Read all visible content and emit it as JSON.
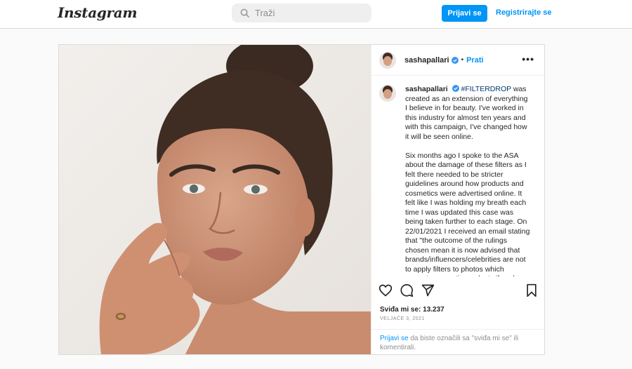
{
  "header": {
    "logo": "Instagram",
    "search_placeholder": "Traži",
    "login_label": "Prijavi se",
    "signup_label": "Registrirajte se"
  },
  "post": {
    "username": "sashapallari",
    "follow_label": "Prati",
    "more_label": "•••",
    "caption": {
      "hashtag": "#FILTERDROP",
      "text": " was created as an extension of everything I believe in for beauty. I've worked in this industry for almost ten years and with this campaign, I've changed how it will be seen online.\n\nSix months ago I spoke to the ASA about the damage of these filters as I felt there needed to be stricter guidelines around how products and cosmetics were advertised online. It felt like I was holding my breath each time I was updated this case was being taken further to each stage. On 22/01/2021 I received an email stating that \"the outcome of the rulings chosen mean it is now advised that brands/influencers/celebrities are not to apply filters to photos which promote cosmetic products if such"
    },
    "likes_text": "Sviđa mi se: 13.237",
    "date": "VELJAČE 3, 2021",
    "login_note": {
      "link": "Prijavi se",
      "text": " da biste označili sa \"sviđa mi se\" ili komentirali."
    }
  },
  "colors": {
    "accent": "#0095f6",
    "verified": "#3897f0",
    "border": "#dbdbdb"
  },
  "icons": [
    "search-icon",
    "verified-icon",
    "more-icon",
    "heart-icon",
    "comment-icon",
    "share-icon",
    "bookmark-icon"
  ]
}
